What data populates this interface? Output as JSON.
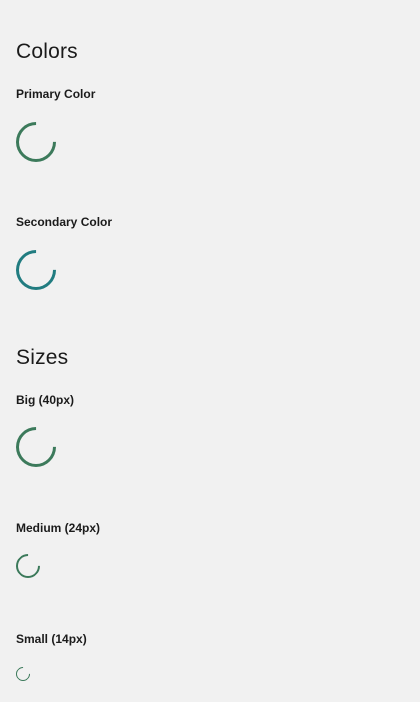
{
  "colors_section": {
    "title": "Colors",
    "primary": {
      "label": "Primary Color",
      "color": "#3c7a5b"
    },
    "secondary": {
      "label": "Secondary Color",
      "color": "#217c80"
    }
  },
  "sizes_section": {
    "title": "Sizes",
    "big": {
      "label": "Big (40px)"
    },
    "medium": {
      "label": "Medium (24px)"
    },
    "small": {
      "label": "Small (14px)"
    }
  }
}
